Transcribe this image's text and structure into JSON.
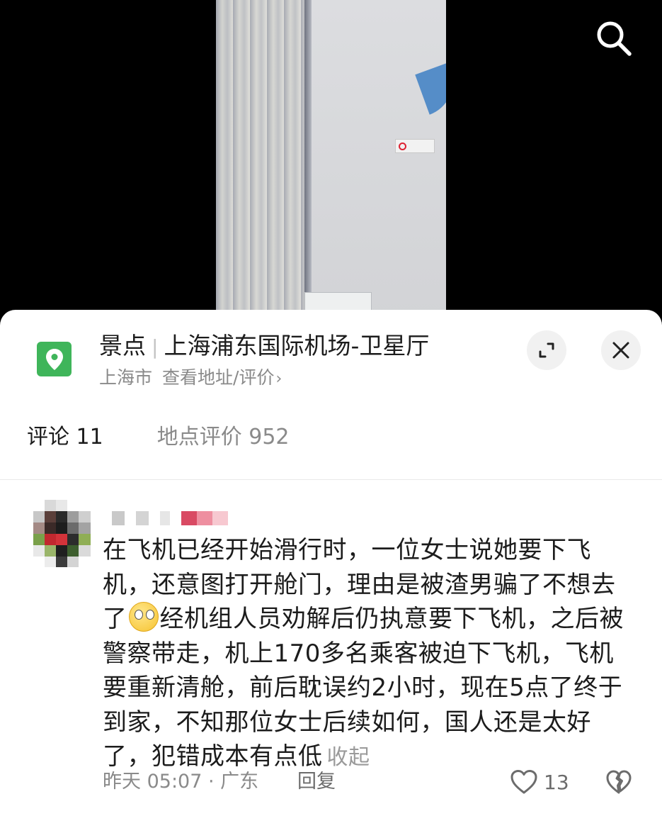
{
  "header": {
    "search_icon": "search-icon"
  },
  "location": {
    "category": "景点",
    "name": "上海浦东国际机场-卫星厅",
    "city": "上海市",
    "link_text": "查看地址/评价",
    "chevron": "›",
    "icon": "location-pin-icon",
    "accent_color": "#3fb55a"
  },
  "tabs": [
    {
      "label": "评论 11"
    },
    {
      "label": "地点评价 952"
    }
  ],
  "comment": {
    "text_part1": "在飞机已经开始滑行时，一位女士说她要下飞机，还意图打开舱门，理由是被渣男骗了不想去了",
    "emoji": "crying-emoji",
    "text_part2": "经机组人员劝解后仍执意要下飞机，之后被警察带走，机上170多名乘客被迫下飞机，飞机要重新清舱，前后耽误约2小时，现在5点了终于到家，不知那位女士后续如何，国人还是太好了，犯错成本有点低",
    "collapse_label": "收起",
    "meta": "昨天 05:07 · 广东",
    "reply_label": "回复",
    "like_count": "13"
  }
}
